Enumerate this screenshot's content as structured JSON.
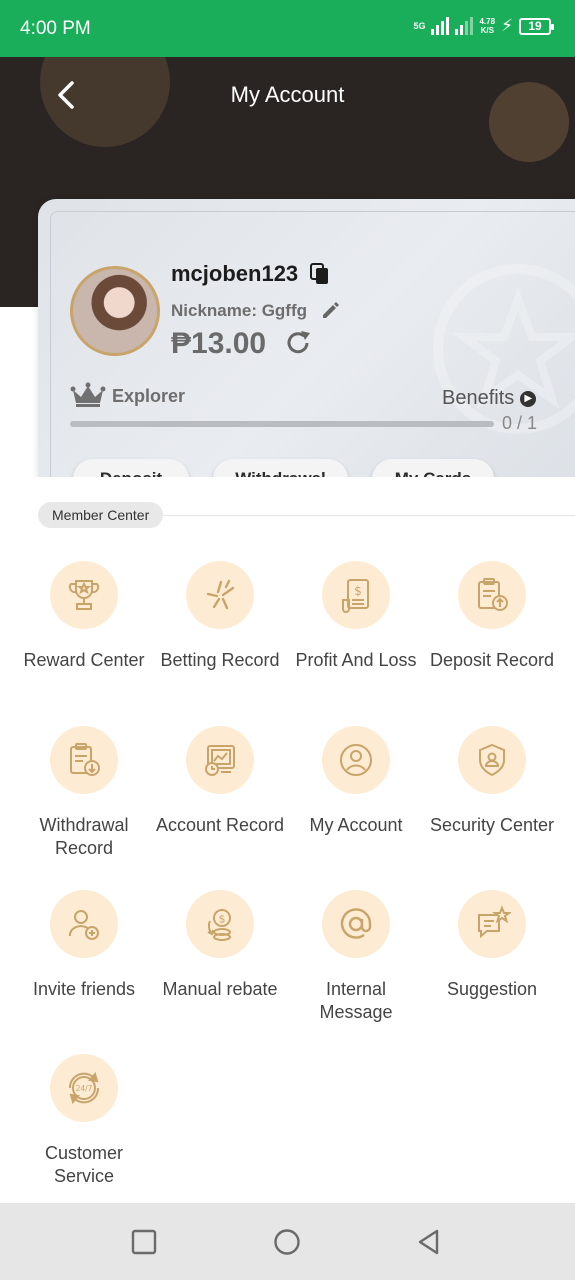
{
  "status_bar": {
    "time": "4:00 PM",
    "network": "5G",
    "speed_value": "4.78",
    "speed_unit": "K/S",
    "battery": "19"
  },
  "header": {
    "title": "My Account"
  },
  "account": {
    "username": "mcjoben123",
    "nickname": "Nickname: Ggffg",
    "balance": "₱13.00",
    "level": "Explorer",
    "benefits_label": "Benefits",
    "progress_text": "0 / 1",
    "progress_fraction": 0,
    "buttons": {
      "deposit": "Deposit",
      "withdrawal": "Withdrawal",
      "my_cards": "My Cards"
    }
  },
  "member_center": {
    "title": "Member Center",
    "items": [
      {
        "label": "Reward Center",
        "icon": "trophy-icon"
      },
      {
        "label": "Betting Record",
        "icon": "stars-icon"
      },
      {
        "label": "Profit And Loss",
        "icon": "document-dollar-icon"
      },
      {
        "label": "Deposit Record",
        "icon": "clipboard-upload-icon"
      },
      {
        "label": "Withdrawal Record",
        "icon": "clipboard-download-icon"
      },
      {
        "label": "Account Record",
        "icon": "chart-clock-icon"
      },
      {
        "label": "My Account",
        "icon": "user-circle-icon"
      },
      {
        "label": "Security Center",
        "icon": "shield-user-icon"
      },
      {
        "label": "Invite friends",
        "icon": "user-add-icon"
      },
      {
        "label": "Manual rebate",
        "icon": "coins-icon"
      },
      {
        "label": "Internal Message",
        "icon": "at-sign-icon"
      },
      {
        "label": "Suggestion",
        "icon": "chat-star-icon"
      },
      {
        "label": "Customer Service",
        "icon": "support-24-7-icon"
      }
    ]
  },
  "colors": {
    "status_bar": "#1aae5a",
    "header_bg": "#2a2522",
    "icon_bg": "#fdecd3",
    "icon_stroke": "#c9a46a"
  }
}
